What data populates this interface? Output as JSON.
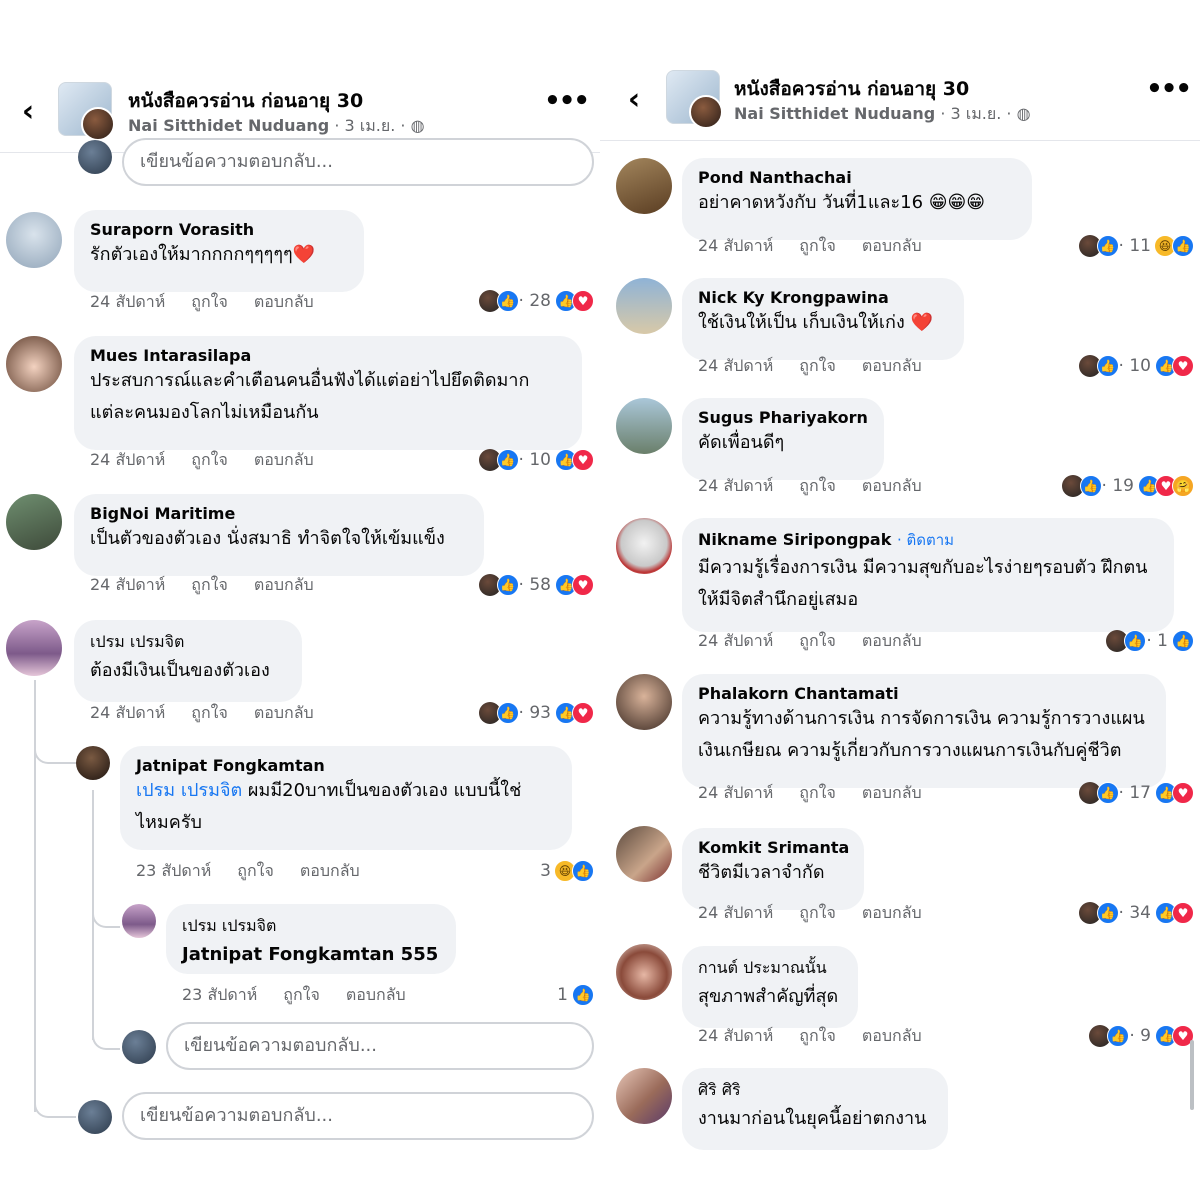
{
  "header": {
    "title": "หนังสือควรอ่าน ก่อนอายุ 30",
    "author": "Nai Sitthidet Nuduang",
    "date": "· 3 เม.ย. ·",
    "back_icon": "‹",
    "more_icon": "•••"
  },
  "actions": {
    "like": "ถูกใจ",
    "reply": "ตอบกลับ"
  },
  "reply_placeholder": "เขียนข้อความตอบกลับ...",
  "left": {
    "comments": [
      {
        "name": "Suraporn Vorasith",
        "text": "รักตัวเองให้มากกกกๆๆๆๆๆ❤️",
        "time": "24 สัปดาห์",
        "count": "· 28"
      },
      {
        "name": "Mues Intarasilapa",
        "text1": "ประสบการณ์และคำเตือนคนอื่นฟังได้แต่อย่าไปยึดติดมาก",
        "text2": "แต่ละคนมองโลกไม่เหมือนกัน",
        "time": "24 สัปดาห์",
        "count": "· 10"
      },
      {
        "name": "BigNoi Maritime",
        "text": "เป็นตัวของตัวเอง นั่งสมาธิ ทำจิตใจให้เข้มแข็ง",
        "time": "24 สัปดาห์",
        "count": "· 58"
      },
      {
        "name": "เปรม เปรมจิต",
        "text": "ต้องมีเงินเป็นของตัวเอง",
        "time": "24 สัปดาห์",
        "count": "· 93"
      }
    ],
    "replies": [
      {
        "name": "Jatnipat Fongkamtan",
        "mention": "เปรม เปรมจิต",
        "text1": " ผมมี20บาทเป็นของตัวเอง แบบนี้ใช่",
        "text2": "ไหมครับ",
        "time": "23 สัปดาห์",
        "count": "3"
      },
      {
        "name": "เปรม เปรมจิต",
        "text": "Jatnipat Fongkamtan 555",
        "time": "23 สัปดาห์",
        "count": "1"
      }
    ]
  },
  "right": {
    "comments": [
      {
        "name": "Pond Nanthachai",
        "text": "อย่าคาดหวังกับ วันที่1และ16 😁😁😁",
        "time": "24 สัปดาห์",
        "count": "· 11"
      },
      {
        "name": "Nick Ky Krongpawina",
        "text": "ใช้เงินให้เป็น เก็บเงินให้เก่ง ❤️",
        "time": "24 สัปดาห์",
        "count": "· 10"
      },
      {
        "name": "Sugus Phariyakorn",
        "text": "คัดเพื่อนดีๆ",
        "time": "24 สัปดาห์",
        "count": "· 19"
      },
      {
        "name": "Nikname Siripongpak",
        "follow": "· ติดตาม",
        "text1": "มีความรู้เรื่องการเงิน มีความสุขกับอะไรง่ายๆรอบตัว ฝึกตน",
        "text2": "ให้มีจิตสำนึกอยู่เสมอ",
        "time": "24 สัปดาห์",
        "count": "· 1"
      },
      {
        "name": "Phalakorn Chantamati",
        "text1": "ความรู้ทางด้านการเงิน การจัดการเงิน ความรู้การวางแผน",
        "text2": "เงินเกษียณ ความรู้เกี่ยวกับการวางแผนการเงินกับคู่ชีวิต",
        "time": "24 สัปดาห์",
        "count": "· 17"
      },
      {
        "name": "Komkit Srimanta",
        "text": "ชีวิตมีเวลาจำกัด",
        "time": "24 สัปดาห์",
        "count": "· 34"
      },
      {
        "name": "กานต์ ประมาณนั้น",
        "text": "สุขภาพสำคัญที่สุด",
        "time": "24 สัปดาห์",
        "count": "· 9"
      },
      {
        "name": "ศิริ ศิริ",
        "text": "งานมาก่อนในยุคนี้อย่าตกงาน"
      }
    ]
  }
}
